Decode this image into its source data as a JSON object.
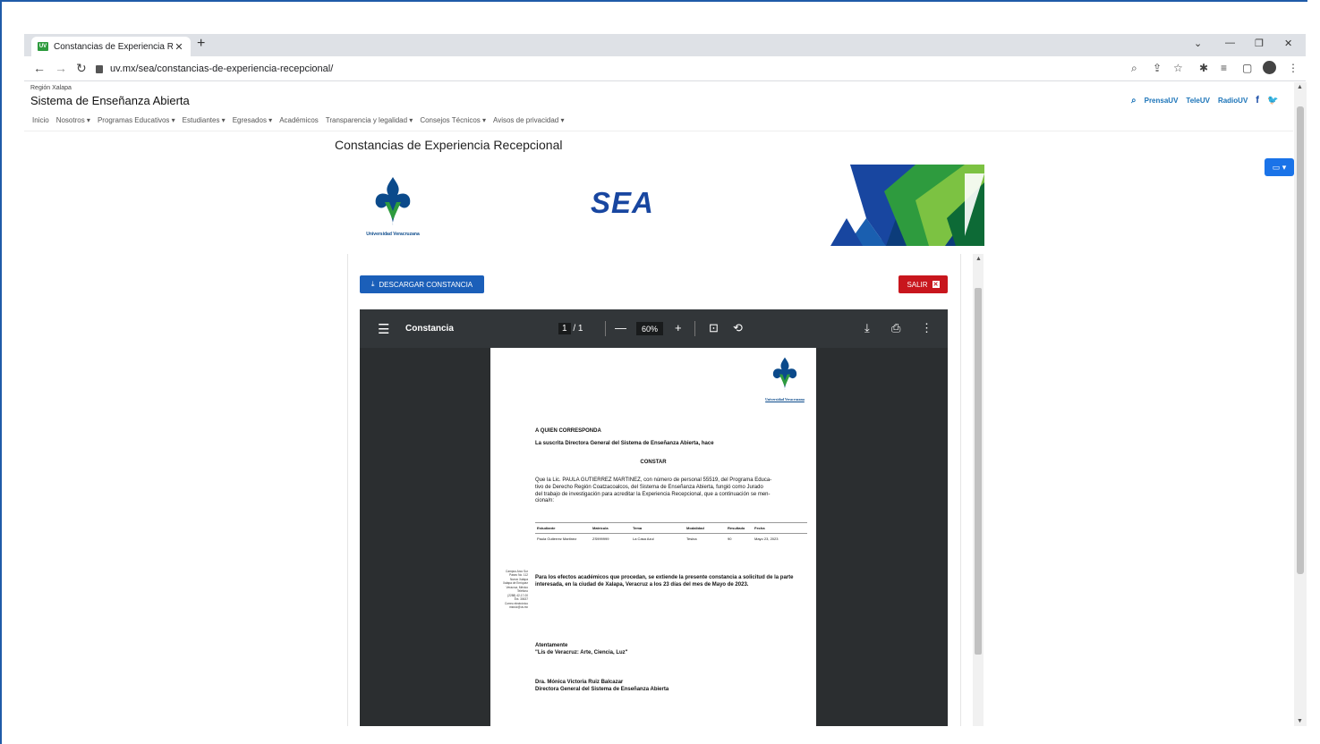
{
  "browser": {
    "tab_title": "Constancias de Experiencia Recep",
    "tab_favicon": "UV",
    "url": "uv.mx/sea/constancias-de-experiencia-recepcional/"
  },
  "site": {
    "region": "Región Xalapa",
    "title": "Sistema de Enseñanza Abierta",
    "header_links": [
      "PrensaUV",
      "TeleUV",
      "RadioUV"
    ],
    "nav": [
      "Inicio",
      "Nosotros ▾",
      "Programas Educativos ▾",
      "Estudiantes ▾",
      "Egresados ▾",
      "Académicos",
      "Transparencia y legalidad ▾",
      "Consejos Técnicos ▾",
      "Avisos de privacidad ▾"
    ]
  },
  "page": {
    "heading": "Constancias de Experiencia Recepcional",
    "uv_logo_caption": "Universidad Veracruzana",
    "sea_logo": "SEA",
    "download_button": "DESCARGAR CONSTANCIA",
    "exit_button": "SALIR"
  },
  "pdf": {
    "title": "Constancia",
    "page_current": "1",
    "page_total": "/ 1",
    "zoom": "60%"
  },
  "document": {
    "logo_caption": "Universidad Veracruzana",
    "salutation": "A QUIEN CORRESPONDA",
    "intro": "La suscrita Directora General del Sistema de Enseñanza Abierta, hace",
    "constar": "CONSTAR",
    "body_p1": "Que la Lic. PAULA GUTIERREZ MARTINEZ, con número de personal 55519, del Programa Educa-",
    "body_p2": "tivo de Derecho Región Coatzacoalcos, del Sistema de Enseñanza Abierta, fungió como Jurado",
    "body_p3": "del trabajo de investigación para acreditar la Experiencia Recepcional, que a continuación se men-",
    "body_p4": "ciona/n:",
    "table_headers": [
      "Estudiante",
      "Matrícula",
      "Tema",
      "Modalidad",
      "Resultado",
      "Fecha"
    ],
    "table_rows": [
      [
        "Paula Gutierrez Martinez",
        "ZS999999",
        "La Casa Azul",
        "Tesina",
        "90",
        "Mayo 23, 2023"
      ]
    ],
    "closing_1": "Para los efectos académicos que procedan, se extiende la presente constancia a solicitud de la parte",
    "closing_2": "interesada, en la ciudad de Xalapa, Veracruz a los 23 días del mes de Mayo de 2023.",
    "sign_1": "Atentamente",
    "sign_2": "\"Lis de Veracruz: Arte, Ciencia, Luz\"",
    "signer_name": "Dra. Mónica Victoria Ruiz Balcazar",
    "signer_title": "Directora General del Sistema de Enseñanza Abierta",
    "side_contact": [
      "Campus Arco Sur",
      "Paseo No. 112",
      "Nuevo Xalapa",
      "Xalapa de Enríquez",
      "Veracruz, México",
      "Teléfono",
      "(2288) 42-17-00",
      "Ext. 30637",
      "Correo electrónico",
      "msruiz@uv.mx"
    ]
  },
  "colors": {
    "primary_blue": "#1b5fb9",
    "exit_red": "#c8161d",
    "uv_green": "#2e9b3e",
    "sea_blue": "#1846a0"
  }
}
